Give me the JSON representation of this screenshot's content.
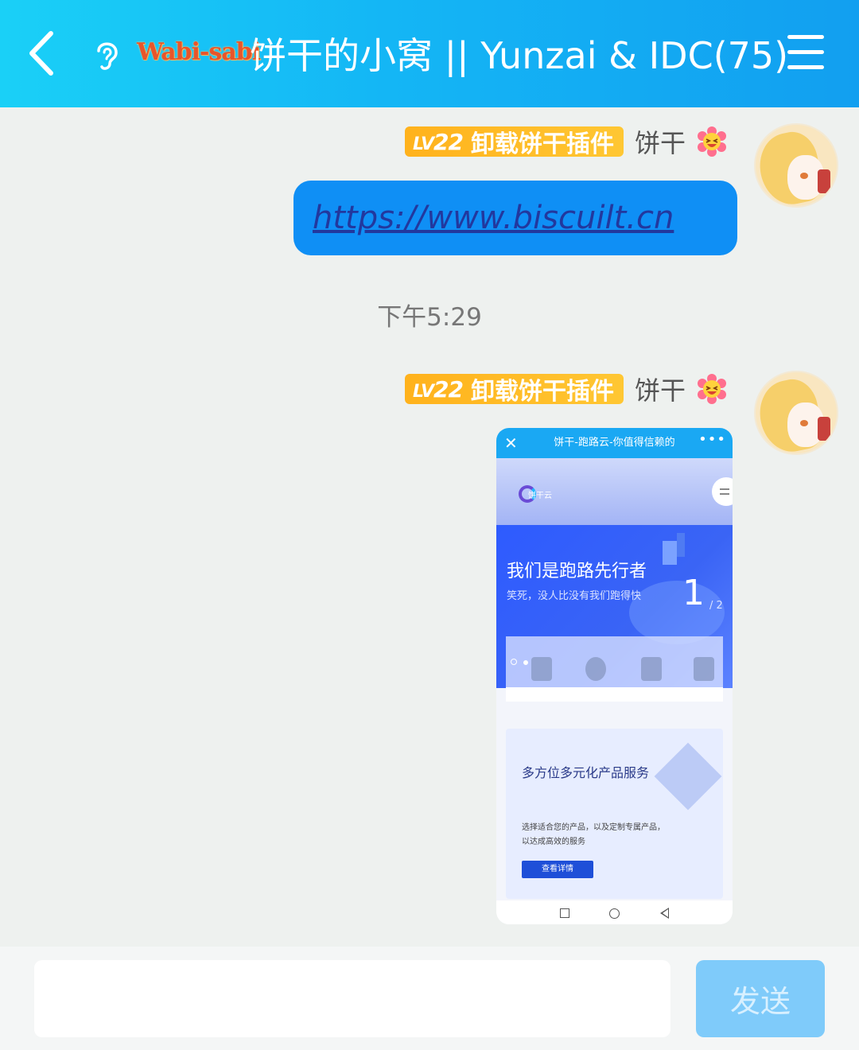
{
  "header": {
    "logo_text": "Wabi-sabi",
    "title": "饼干的小窝 || Yunzai & IDC(75)"
  },
  "messages": [
    {
      "sender": {
        "level": "22",
        "level_prefix": "LV",
        "tag": "卸载饼干插件",
        "name": "饼干"
      },
      "link": "https://www.biscuilt.cn"
    },
    {
      "timestamp": "下午5:29"
    },
    {
      "sender": {
        "level": "22",
        "level_prefix": "LV",
        "tag": "卸载饼干插件",
        "name": "饼干"
      },
      "screenshot": {
        "bar_title": "饼干-跑路云-你值得信赖的",
        "close": "✕",
        "more": "•••",
        "logo_text": "饼干云",
        "hero_title": "我们是跑路先行者",
        "hero_subtitle": "笑死，没人比没有我们跑得快",
        "page_current": "1",
        "page_total": "/ 2",
        "card_title": "多方位多元化产品服务",
        "card_desc": "选择适合您的产品，以及定制专属产品，以达成高效的服务",
        "card_button": "查看详情"
      }
    }
  ],
  "input": {
    "placeholder": "",
    "value": ""
  },
  "send_label": "发送",
  "colors": {
    "header_start": "#1ad0f7",
    "header_end": "#129ff0",
    "bubble": "#0f8ff5",
    "badge": "#ffb21c",
    "send_disabled": "#7fcbfa"
  }
}
